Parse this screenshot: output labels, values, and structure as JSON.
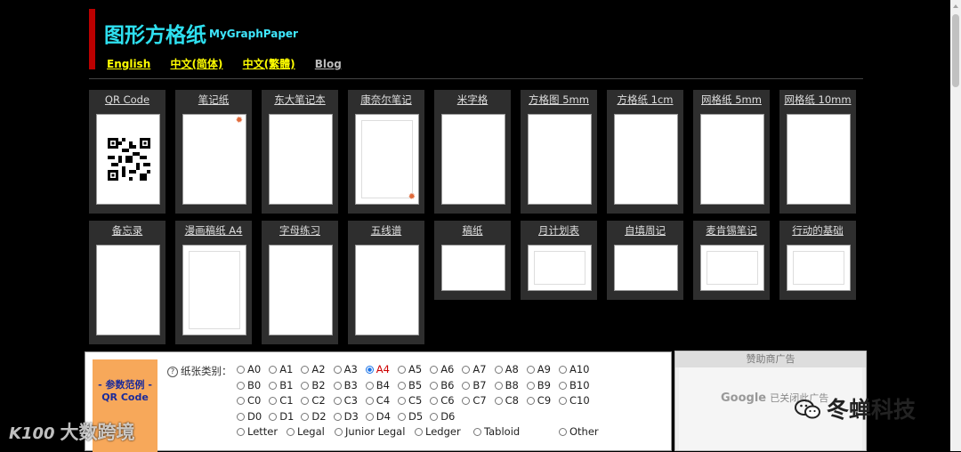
{
  "header": {
    "title": "图形方格纸",
    "subtitle": "MyGraphPaper",
    "languages": [
      "English",
      "中文(简体)",
      "中文(繁體)"
    ],
    "blog": "Blog",
    "colors": {
      "accent_bar": "#bb0000",
      "title": "#2ee0f0",
      "lang_link": "#ffff00"
    }
  },
  "gallery": {
    "row1": [
      "QR Code",
      "笔记纸",
      "东大笔记本",
      "康奈尔笔记",
      "米字格",
      "方格图 5mm",
      "方格纸 1cm",
      "网格纸 5mm",
      "网格纸 10mm"
    ],
    "row2": [
      "备忘录",
      "漫画稿纸 A4",
      "字母练习",
      "五线谱",
      "稿纸",
      "月计划表",
      "自填周记",
      "麦肯锡笔记",
      "行动的基础"
    ]
  },
  "params": {
    "tab_line1": "- 参数范例 -",
    "tab_line2": "QR Code",
    "paper_label": "纸张类别：",
    "selected": "A4",
    "sizes": [
      [
        "A0",
        "A1",
        "A2",
        "A3",
        "A4",
        "A5",
        "A6",
        "A7",
        "A8",
        "A9",
        "A10"
      ],
      [
        "B0",
        "B1",
        "B2",
        "B3",
        "B4",
        "B5",
        "B6",
        "B7",
        "B8",
        "B9",
        "B10"
      ],
      [
        "C0",
        "C1",
        "C2",
        "C3",
        "C4",
        "C5",
        "C6",
        "C7",
        "C8",
        "C9",
        "C10"
      ],
      [
        "D0",
        "D1",
        "D2",
        "D3",
        "D4",
        "D5",
        "D6"
      ]
    ],
    "special": [
      "Letter",
      "Legal",
      "Junior Legal",
      "Ledger",
      "Tabloid",
      "Other"
    ]
  },
  "ad": {
    "header": "赞助商广告",
    "google": "Google",
    "closed": "已关闭此广告"
  },
  "watermarks": {
    "left_logo": "K100",
    "left": "大数跨境",
    "right": "冬蝉科技"
  }
}
